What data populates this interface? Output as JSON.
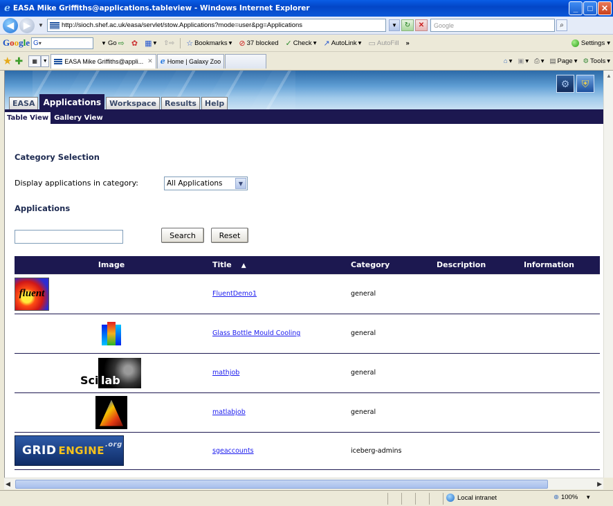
{
  "window": {
    "title": "EASA Mike Griffiths@applications.tableview - Windows Internet Explorer"
  },
  "address_bar": {
    "url": "http://sioch.shef.ac.uk/easa/servlet/stow.Applications?mode=user&pg=Applications",
    "search_placeholder": "Google"
  },
  "google_toolbar": {
    "input_value": "G",
    "go_label": "Go",
    "bookmarks_label": "Bookmarks",
    "blocked_label": "37 blocked",
    "check_label": "Check",
    "autolink_label": "AutoLink",
    "autofill_label": "AutoFill",
    "more_label": "»",
    "settings_label": "Settings"
  },
  "browser_tabs": {
    "tabs": [
      {
        "label": "EASA Mike Griffiths@appli..."
      },
      {
        "label": "Home | Galaxy Zoo"
      }
    ],
    "page_label": "Page",
    "tools_label": "Tools"
  },
  "app_nav": {
    "tabs": [
      "EASA",
      "Applications",
      "Workspace",
      "Results",
      "Help"
    ],
    "active_tab": "Applications",
    "subtabs": [
      "Table View",
      "Gallery View"
    ],
    "active_subtab": "Table View"
  },
  "main": {
    "category_heading": "Category Selection",
    "category_label": "Display applications in category:",
    "category_value": "All Applications",
    "applications_heading": "Applications",
    "search_value": "",
    "search_button": "Search",
    "reset_button": "Reset",
    "table": {
      "columns": [
        "Image",
        "Title",
        "Category",
        "Description",
        "Information"
      ],
      "rows": [
        {
          "image": "fluent-logo",
          "image_text": "fluent",
          "title": "FluentDemo1",
          "category": "general",
          "description": "",
          "information": ""
        },
        {
          "image": "glass-bottle-thumbnail",
          "image_text": "",
          "title": "Glass Bottle Mould Cooling",
          "category": "general",
          "description": "",
          "information": ""
        },
        {
          "image": "scilab-logo",
          "image_text": "Scilab",
          "title": "mathjob",
          "category": "general",
          "description": "",
          "information": ""
        },
        {
          "image": "matlab-logo",
          "image_text": "",
          "title": "matlabjob",
          "category": "general",
          "description": "",
          "information": ""
        },
        {
          "image": "grid-engine-logo",
          "image_text": "GRIDENGINE.org",
          "title": "sgeaccounts",
          "category": "iceberg-admins",
          "description": "",
          "information": ""
        }
      ]
    }
  },
  "status_bar": {
    "zone": "Local intranet",
    "zoom": "100%"
  }
}
